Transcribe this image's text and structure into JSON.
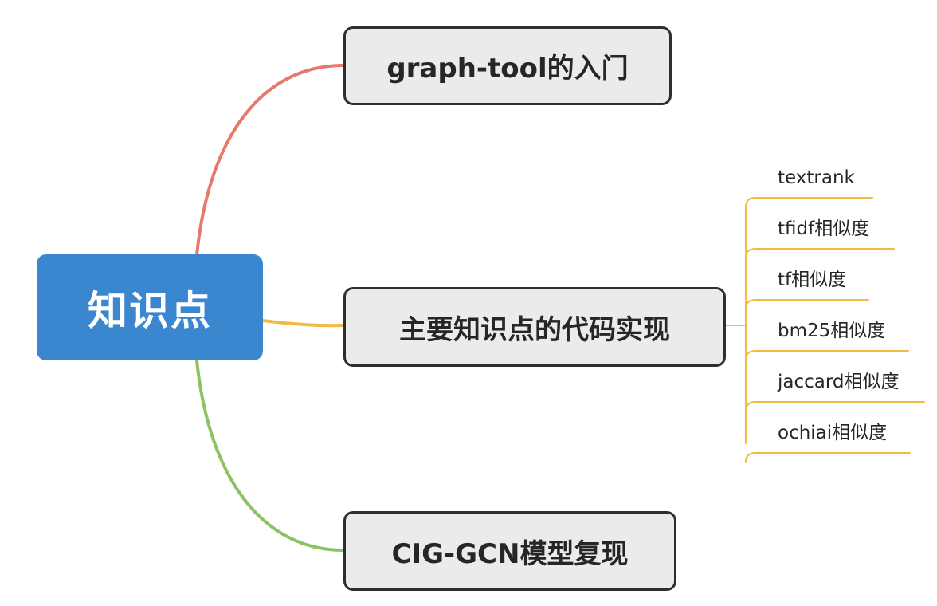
{
  "root": {
    "label": "知识点",
    "color": "#3b87cf"
  },
  "branches": [
    {
      "label": "graph-tool的入门",
      "edge_color": "#e8786a"
    },
    {
      "label": "主要知识点的代码实现",
      "edge_color": "#f2bb44"
    },
    {
      "label": "CIG-GCN模型复现",
      "edge_color": "#8cc261"
    }
  ],
  "leaves": {
    "parent": "主要知识点的代码实现",
    "edge_color": "#f2bb44",
    "items": [
      {
        "label": "textrank"
      },
      {
        "label": "tfidf相似度"
      },
      {
        "label": "tf相似度"
      },
      {
        "label": "bm25相似度"
      },
      {
        "label": "jaccard相似度"
      },
      {
        "label": "ochiai相似度"
      }
    ]
  }
}
